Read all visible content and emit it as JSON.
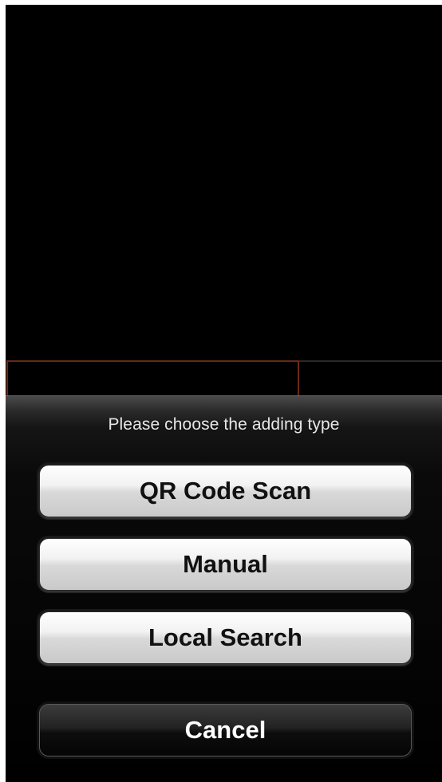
{
  "action_sheet": {
    "title": "Please choose the adding type",
    "buttons": {
      "qr_code_scan": "QR Code Scan",
      "manual": "Manual",
      "local_search": "Local Search",
      "cancel": "Cancel"
    }
  },
  "colors": {
    "screen_background": "#000000",
    "selected_tab_border": "#6b2a14",
    "button_light": "#e6e6e6",
    "button_dark": "#1a1a1a"
  }
}
